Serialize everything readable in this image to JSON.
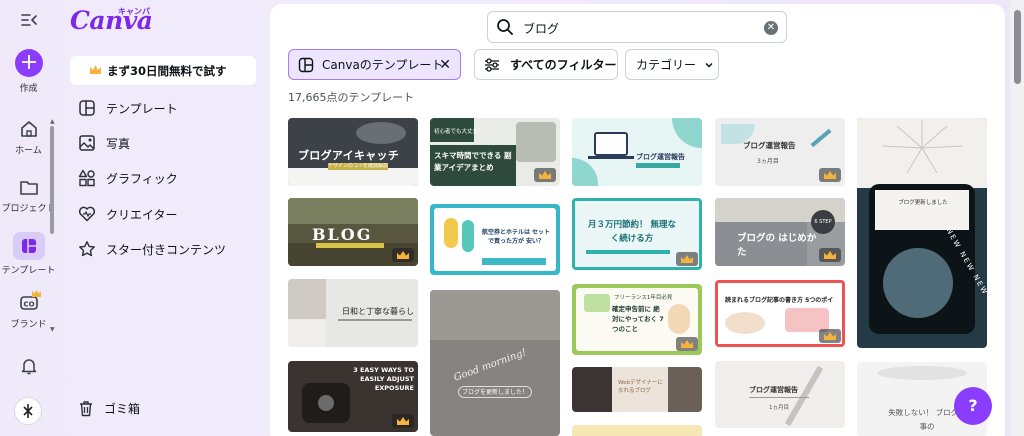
{
  "rail": {
    "create_label": "作成",
    "items": [
      {
        "label": "ホーム",
        "icon": "home-icon"
      },
      {
        "label": "プロジェクト",
        "icon": "folder-icon"
      },
      {
        "label": "テンプレート",
        "icon": "template-icon"
      },
      {
        "label": "ブランド",
        "icon": "brand-icon"
      }
    ]
  },
  "brand": {
    "logo": "Canva",
    "kana": "キャンバ",
    "color": "#7d2ae8"
  },
  "panel": {
    "trial": "まず30日間無料で試す",
    "nav": [
      {
        "label": "テンプレート",
        "icon": "template-icon"
      },
      {
        "label": "写真",
        "icon": "photo-icon"
      },
      {
        "label": "グラフィック",
        "icon": "shapes-icon"
      },
      {
        "label": "クリエイター",
        "icon": "heart-icon"
      },
      {
        "label": "スター付きコンテンツ",
        "icon": "star-icon"
      }
    ],
    "trash": "ゴミ箱"
  },
  "search": {
    "query": "ブログ",
    "placeholder": ""
  },
  "filters": {
    "active_chip": "Canvaのテンプレート",
    "all_filters": "すべてのフィルター",
    "category": "カテゴリー"
  },
  "results": {
    "count": "17,665点のテンプレート"
  },
  "templates": [
    {
      "text": "ブログアイキャッチ",
      "sub": "デザインのコツを徹底解説",
      "bg": "#3d4248",
      "premium": false
    },
    {
      "text": "BLOG",
      "sub": "",
      "bg": "#58563f",
      "premium": true
    },
    {
      "text": "日和と丁寧な暮らし",
      "sub": "",
      "bg": "#e7e7e5",
      "premium": false
    },
    {
      "text": "3 EASY WAYS TO EASILY ADJUST EXPOSURE",
      "sub": "",
      "bg": "#3a3330",
      "premium": true
    },
    {
      "text": "スキマ時間でできる 副業アイデアまとめ",
      "sub": "初心者でも大丈夫！",
      "bg": "#2e4a3c",
      "premium": true
    },
    {
      "text": "航空券とホテルは セットで買った方が 安い？",
      "sub": "",
      "bg": "#38b8c6",
      "premium": false
    },
    {
      "text": "Good morning!",
      "sub": "ブログを更新しました！",
      "bg": "#878380",
      "premium": false
    },
    {
      "text": "ブログ運営報告",
      "sub": "",
      "bg": "#e8f5f5",
      "premium": false
    },
    {
      "text": "月３万円節約！ 無理なく続ける方",
      "sub": "",
      "bg": "#2fb2a9",
      "premium": true
    },
    {
      "text": "確定申告前に 絶対にやっておく 7つのこと",
      "sub": "フリーランス1年目必見",
      "bg": "#9ac95a",
      "premium": true
    },
    {
      "text": "Webデザイナーになれるブログ",
      "sub": "",
      "bg": "#ece3da",
      "premium": false
    },
    {
      "text": "ブログ運営報告",
      "sub": "3ヵ月目",
      "bg": "#eeeeee",
      "premium": true
    },
    {
      "text": "ブログの はじめかた",
      "sub": "6 STEP",
      "bg": "#9a9da0",
      "premium": true
    },
    {
      "text": "読まれるブログ記事の書き方 5つのポイント",
      "sub": "",
      "bg": "#ee5252",
      "premium": true
    },
    {
      "text": "ブログ運営報告",
      "sub": "1ヵ月目",
      "bg": "#f0efed",
      "premium": false
    },
    {
      "text": "ブログ更新しました",
      "sub": "NEW NEW NEW",
      "bg": "#243a44",
      "premium": false
    },
    {
      "text": "失敗しない！ ブログ記事の",
      "sub": "",
      "bg": "#f3f3f3",
      "premium": false
    }
  ],
  "help": "?"
}
